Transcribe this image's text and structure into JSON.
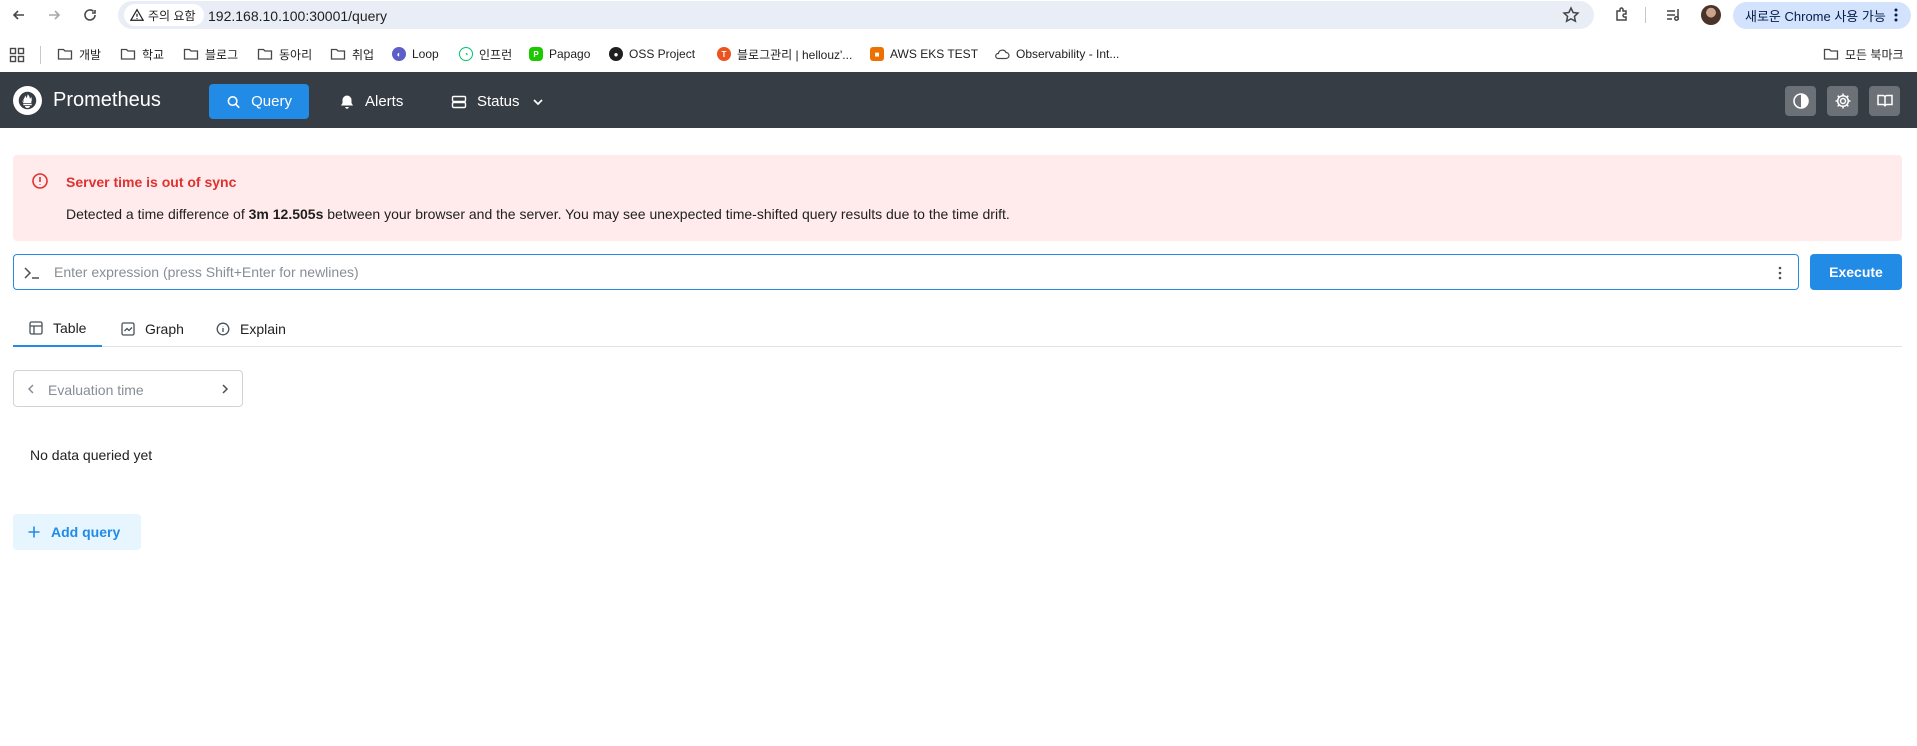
{
  "browser": {
    "security_chip": "주의 요함",
    "url": "192.168.10.100:30001/query",
    "chrome_pill": "새로운 Chrome 사용 가능"
  },
  "bookmarks": {
    "items": [
      {
        "label": "개발",
        "icon": "folder-icon"
      },
      {
        "label": "학교",
        "icon": "folder-icon"
      },
      {
        "label": "블로그",
        "icon": "folder-icon"
      },
      {
        "label": "동아리",
        "icon": "folder-icon"
      },
      {
        "label": "취업",
        "icon": "folder-icon"
      },
      {
        "label": "Loop",
        "icon": "loop-icon"
      },
      {
        "label": "인프런",
        "icon": "inflearn-icon"
      },
      {
        "label": "Papago",
        "icon": "papago-icon"
      },
      {
        "label": "OSS Project",
        "icon": "github-icon"
      },
      {
        "label": "블로그관리 | hellouz'...",
        "icon": "tistory-icon"
      },
      {
        "label": "AWS EKS TEST",
        "icon": "aws-icon"
      },
      {
        "label": "Observability - Int...",
        "icon": "cloud-icon"
      }
    ],
    "all_bookmarks": "모든 북마크"
  },
  "header": {
    "title": "Prometheus",
    "nav": {
      "query": "Query",
      "alerts": "Alerts",
      "status": "Status"
    },
    "brand_color": "#e6522c",
    "accent_color": "#228be6"
  },
  "alert": {
    "title": "Server time is out of sync",
    "body_prefix": "Detected a time difference of ",
    "drift": "3m 12.505s",
    "body_suffix": " between your browser and the server. You may see unexpected time-shifted query results due to the time drift."
  },
  "query": {
    "placeholder": "Enter expression (press Shift+Enter for newlines)",
    "value": "",
    "execute_label": "Execute"
  },
  "tabs": {
    "table": "Table",
    "graph": "Graph",
    "explain": "Explain"
  },
  "eval": {
    "placeholder": "Evaluation time"
  },
  "results": {
    "empty_text": "No data queried yet"
  },
  "actions": {
    "add_query": "Add query"
  }
}
